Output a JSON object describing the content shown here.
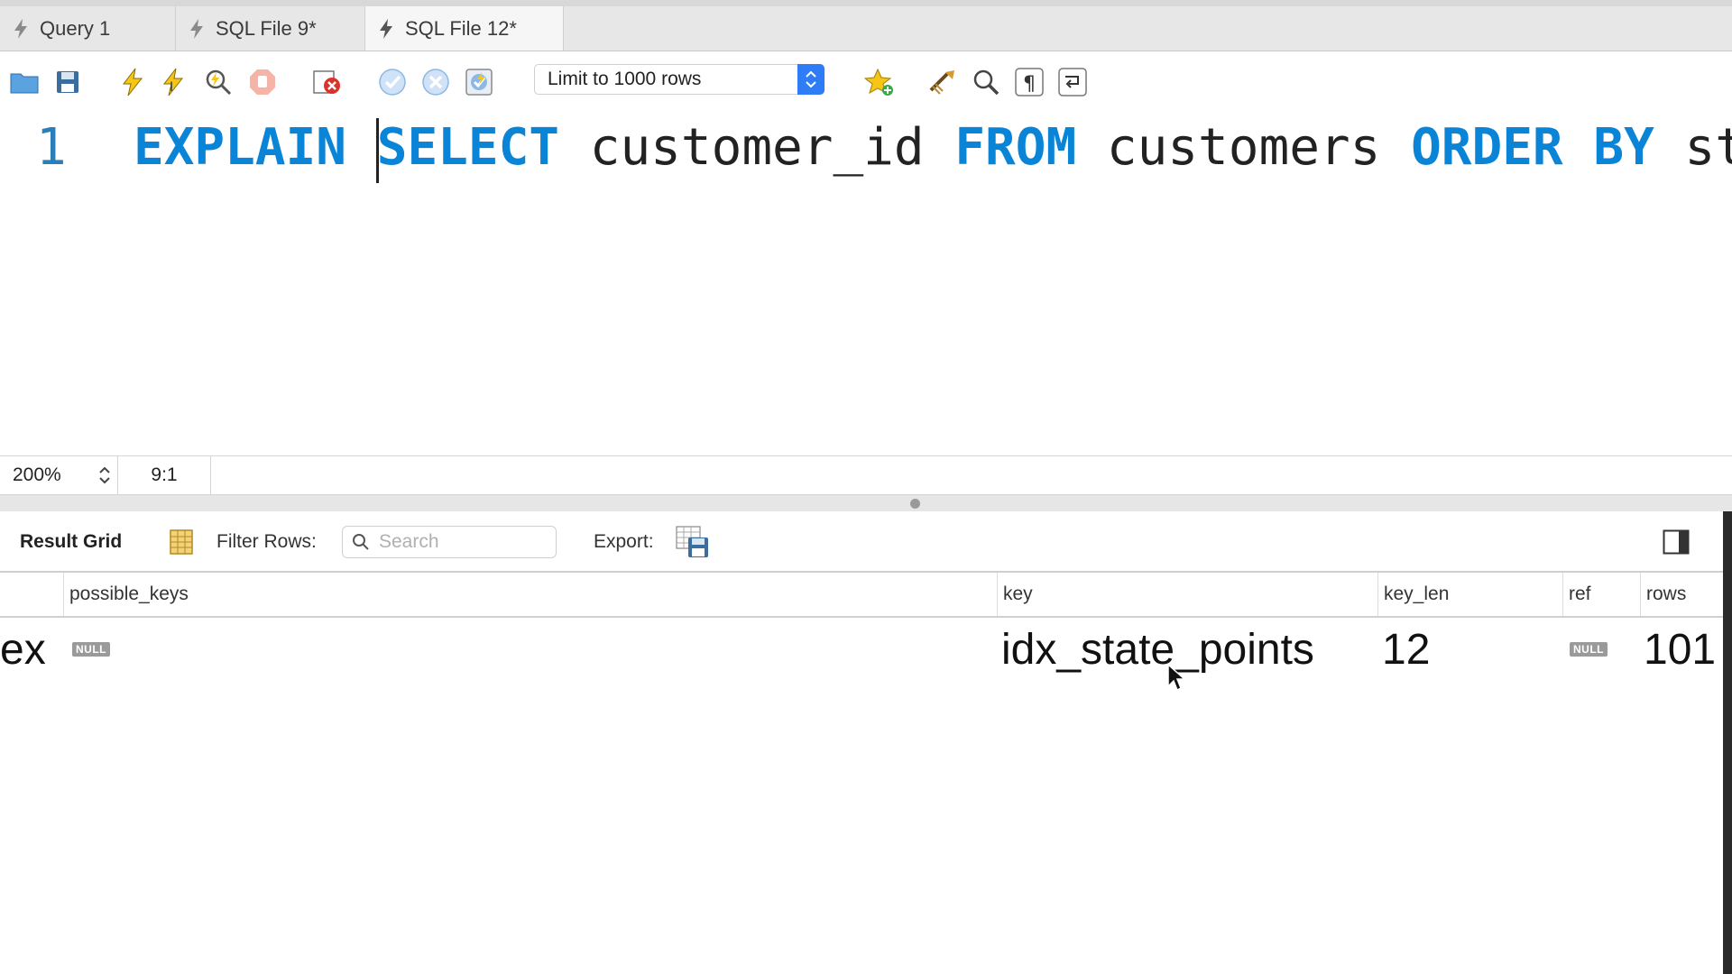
{
  "tabs": [
    {
      "label": "Query 1",
      "active": false
    },
    {
      "label": "SQL File 9*",
      "active": false
    },
    {
      "label": "SQL File 12*",
      "active": true
    }
  ],
  "toolbar": {
    "limit_select_value": "Limit to 1000 rows",
    "icons": [
      "open-folder-icon",
      "save-icon",
      "execute-icon",
      "execute-current-icon",
      "explain-icon",
      "stop-icon",
      "toggle-error-icon",
      "commit-icon",
      "rollback-icon",
      "autocommit-icon",
      "favorite-add-icon",
      "beautify-icon",
      "find-icon",
      "invisible-chars-icon",
      "wrap-icon"
    ]
  },
  "editor": {
    "line_number": "1",
    "code_tokens": [
      {
        "text": "EXPLAIN",
        "keyword": true
      },
      {
        "text": " ",
        "keyword": false
      },
      {
        "text": "SELECT",
        "keyword": true
      },
      {
        "text": " customer_id ",
        "keyword": false
      },
      {
        "text": "FROM",
        "keyword": true
      },
      {
        "text": " customers ",
        "keyword": false
      },
      {
        "text": "ORDER BY",
        "keyword": true
      },
      {
        "text": " st",
        "keyword": false
      }
    ]
  },
  "statusbar": {
    "zoom": "200%",
    "cursor_position": "9:1"
  },
  "result_toolbar": {
    "result_grid_label": "Result Grid",
    "filter_label": "Filter Rows:",
    "search_placeholder": "Search",
    "export_label": "Export:"
  },
  "grid": {
    "columns": [
      "possible_keys",
      "key",
      "key_len",
      "ref",
      "rows"
    ],
    "row": {
      "type_partial": "ex",
      "possible_keys": "NULL",
      "key": "idx_state_points",
      "key_len": "12",
      "ref": "NULL",
      "rows": "101"
    }
  },
  "colors": {
    "keyword": "#0a84d6",
    "line_number": "#2a7fb8",
    "accent": "#2f7df6"
  }
}
